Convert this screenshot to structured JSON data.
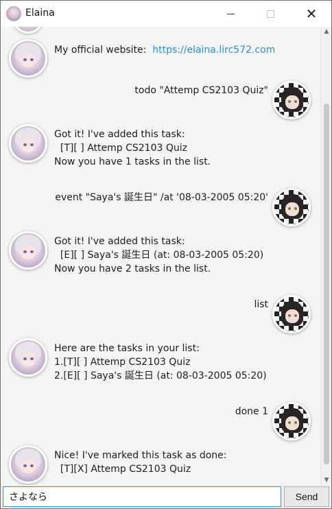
{
  "window": {
    "title": "Elaina",
    "app_icon": "elaina-avatar-icon",
    "max_glyph": "☐",
    "close_glyph": "✕"
  },
  "messages": [
    {
      "sender": "bot",
      "text": "My official website:",
      "link": "https://elaina.lirc572.com"
    },
    {
      "sender": "user",
      "text": "todo \"Attemp CS2103 Quiz\""
    },
    {
      "sender": "bot",
      "text": "Got it! I've added this task:\n  [T][ ] Attemp CS2103 Quiz\nNow you have 1 tasks in the list."
    },
    {
      "sender": "user",
      "text": "event \"Saya's 誕生日\" /at '08-03-2005 05:20'"
    },
    {
      "sender": "bot",
      "text": "Got it! I've added this task:\n  [E][ ] Saya's 誕生日 (at: 08-03-2005 05:20)\nNow you have 2 tasks in the list."
    },
    {
      "sender": "user",
      "text": "list"
    },
    {
      "sender": "bot",
      "text": "Here are the tasks in your list:\n1.[T][ ] Attemp CS2103 Quiz\n2.[E][ ] Saya's 誕生日 (at: 08-03-2005 05:20)"
    },
    {
      "sender": "user",
      "text": "done 1"
    },
    {
      "sender": "bot",
      "text": "Nice! I've marked this task as done:\n  [T][X] Attemp CS2103 Quiz"
    }
  ],
  "input": {
    "value": "さよなら",
    "placeholder": ""
  },
  "send_button": {
    "label": "Send"
  },
  "colors": {
    "link": "#2b8fd6",
    "input_focus_border": "#3a8fd9"
  }
}
